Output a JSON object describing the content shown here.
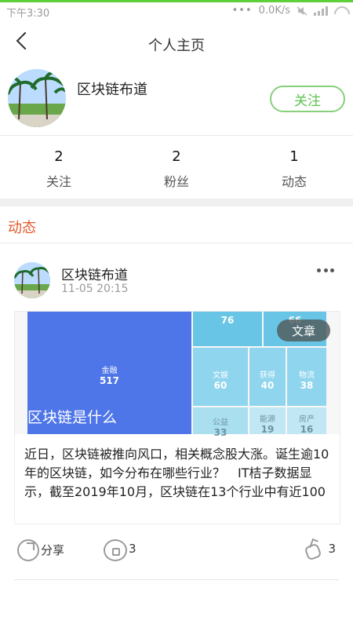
{
  "status_bar": {
    "time": "下午3:30",
    "dots": "•••",
    "network_speed": "0.0K/s",
    "icons": [
      "mute-icon",
      "signal-icon",
      "wifi-icon"
    ]
  },
  "header": {
    "title": "个人主页",
    "back_icon": "back-arrow-icon"
  },
  "profile": {
    "name": "区块链布道",
    "follow_label": "关注",
    "avatar_icon": "avatar"
  },
  "stats": [
    {
      "value": "2",
      "label": "关注"
    },
    {
      "value": "2",
      "label": "粉丝"
    },
    {
      "value": "1",
      "label": "动态"
    }
  ],
  "section": {
    "title": "动态"
  },
  "post": {
    "author": "区块链布道",
    "time": "11-05 20:15",
    "more_icon": "more-icon",
    "card": {
      "badge": "文章",
      "overlay_title": "区块链是什么",
      "text": "近日，区块链被推向风口，相关概念股大涨。诞生逾10年的区块链，如今分布在哪些行业？　IT桔子数据显示，截至2019年10月，区块链在13个行业中有近100",
      "treemap": {
        "blocks": [
          {
            "label": "金融",
            "value": "517",
            "color": "#4e76e8"
          },
          {
            "label": "",
            "value": "76",
            "color": "#68c5e6"
          },
          {
            "label": "",
            "value": "66",
            "color": "#68c5e6"
          },
          {
            "label": "文娱",
            "value": "60",
            "color": "#8fd5ee"
          },
          {
            "label": "获得",
            "value": "40",
            "color": "#8fd5ee"
          },
          {
            "label": "物流",
            "value": "38",
            "color": "#8fd5ee"
          },
          {
            "label": "公益",
            "value": "33",
            "color": "#a9dfef"
          },
          {
            "label": "能源",
            "value": "19",
            "color": "#c0e7f3"
          },
          {
            "label": "房产",
            "value": "16",
            "color": "#c0e7f3"
          }
        ]
      }
    },
    "actions": {
      "share_label": "分享",
      "comment_count": "3",
      "like_count": "3"
    }
  },
  "colors": {
    "accent_green": "#5fcf3a",
    "follow_green": "#5ac24d",
    "section_orange": "#e3572b"
  }
}
